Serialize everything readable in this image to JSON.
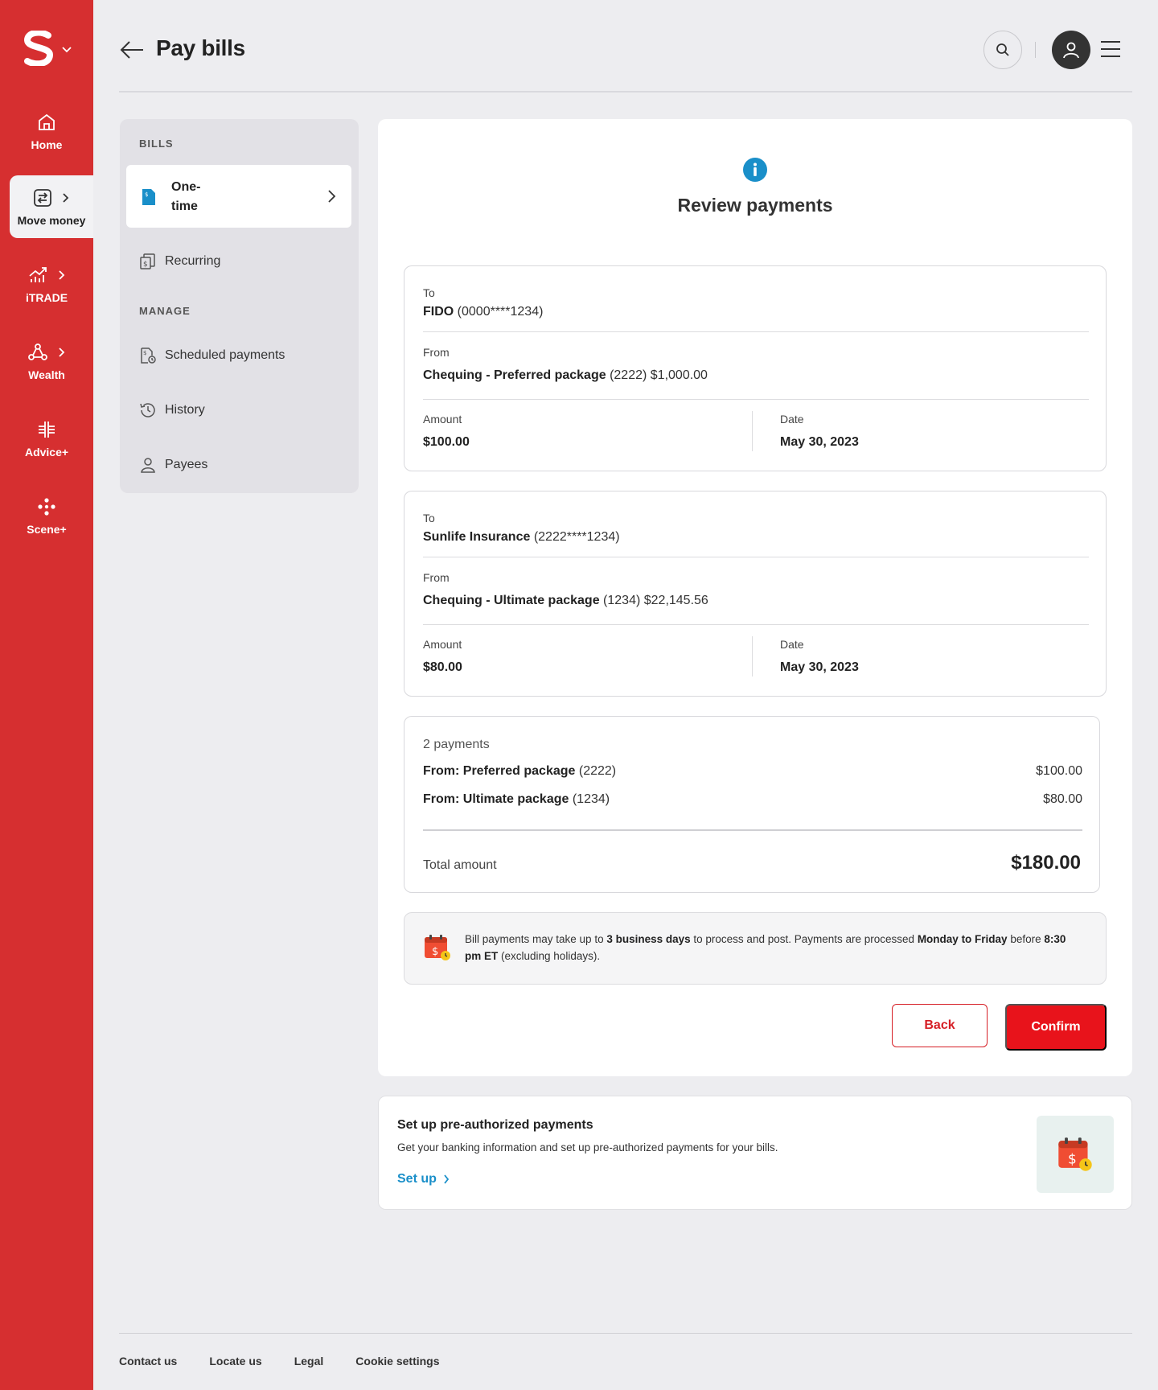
{
  "header": {
    "title": "Pay bills"
  },
  "rail": {
    "items": [
      {
        "label": "Home",
        "icon": "home-icon"
      },
      {
        "label": "Move money",
        "icon": "transfer-icon"
      },
      {
        "label": "iTRADE",
        "icon": "chart-icon"
      },
      {
        "label": "Wealth",
        "icon": "wealth-icon"
      },
      {
        "label": "Advice+",
        "icon": "advice-icon"
      },
      {
        "label": "Scene+",
        "icon": "scene-icon"
      }
    ]
  },
  "subnav": {
    "bills_heading": "BILLS",
    "one_time": "One-time",
    "recurring": "Recurring",
    "manage_heading": "MANAGE",
    "scheduled": "Scheduled payments",
    "history": "History",
    "payees": "Payees"
  },
  "review": {
    "title": "Review payments",
    "labels": {
      "to": "To",
      "from": "From",
      "amount": "Amount",
      "date": "Date"
    },
    "payments": [
      {
        "to_name": "FIDO",
        "to_account": "(0000****1234)",
        "from_name": "Chequing - Preferred package",
        "from_detail": "(2222) $1,000.00",
        "amount": "$100.00",
        "date": "May 30, 2023"
      },
      {
        "to_name": "Sunlife Insurance",
        "to_account": "(2222****1234)",
        "from_name": "Chequing - Ultimate package",
        "from_detail": "(1234) $22,145.56",
        "amount": "$80.00",
        "date": "May 30, 2023"
      }
    ],
    "summary": {
      "count": "2 payments",
      "rows": [
        {
          "label": "From: Preferred package",
          "account": "(2222)",
          "amount": "$100.00"
        },
        {
          "label": "From: Ultimate package",
          "account": "(1234)",
          "amount": "$80.00"
        }
      ],
      "total_label": "Total amount",
      "total_value": "$180.00"
    },
    "notice": {
      "t1": "Bill payments may take up to ",
      "b1": "3 business days",
      "t2": " to process and post. Payments are processed ",
      "b2": "Monday to Friday",
      "t3": " before ",
      "b3": "8:30 pm ET",
      "t4": " (excluding holidays)."
    },
    "back_label": "Back",
    "confirm_label": "Confirm"
  },
  "promo": {
    "title": "Set up pre-authorized payments",
    "desc": "Get your banking information and set up pre-authorized payments for your bills.",
    "link": "Set up"
  },
  "footer": {
    "links": [
      "Contact us",
      "Locate us",
      "Legal",
      "Cookie settings"
    ]
  },
  "colors": {
    "brand_red": "#d62f30",
    "confirm_red": "#e8131b",
    "link_blue": "#1a8fc9",
    "info_blue": "#1a8fc9"
  }
}
